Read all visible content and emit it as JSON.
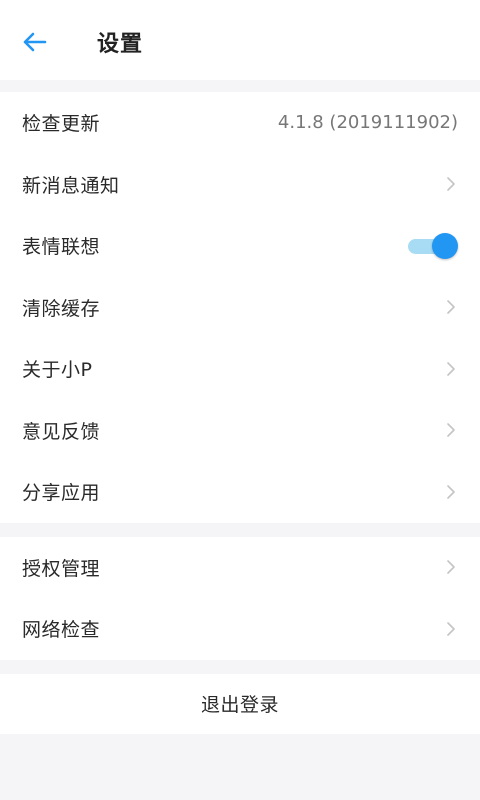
{
  "header": {
    "title": "设置",
    "back_icon": "arrow-left-icon",
    "accent_color": "#2196f3"
  },
  "section_main": {
    "items": [
      {
        "label": "检查更新",
        "value": "4.1.8 (2019111902)"
      },
      {
        "label": "新消息通知"
      },
      {
        "label": "表情联想",
        "toggle_on": true
      },
      {
        "label": "清除缓存"
      },
      {
        "label": "关于小P"
      },
      {
        "label": "意见反馈"
      },
      {
        "label": "分享应用"
      }
    ]
  },
  "section_secondary": {
    "items": [
      {
        "label": "授权管理"
      },
      {
        "label": "网络检查"
      }
    ]
  },
  "logout": {
    "label": "退出登录"
  }
}
